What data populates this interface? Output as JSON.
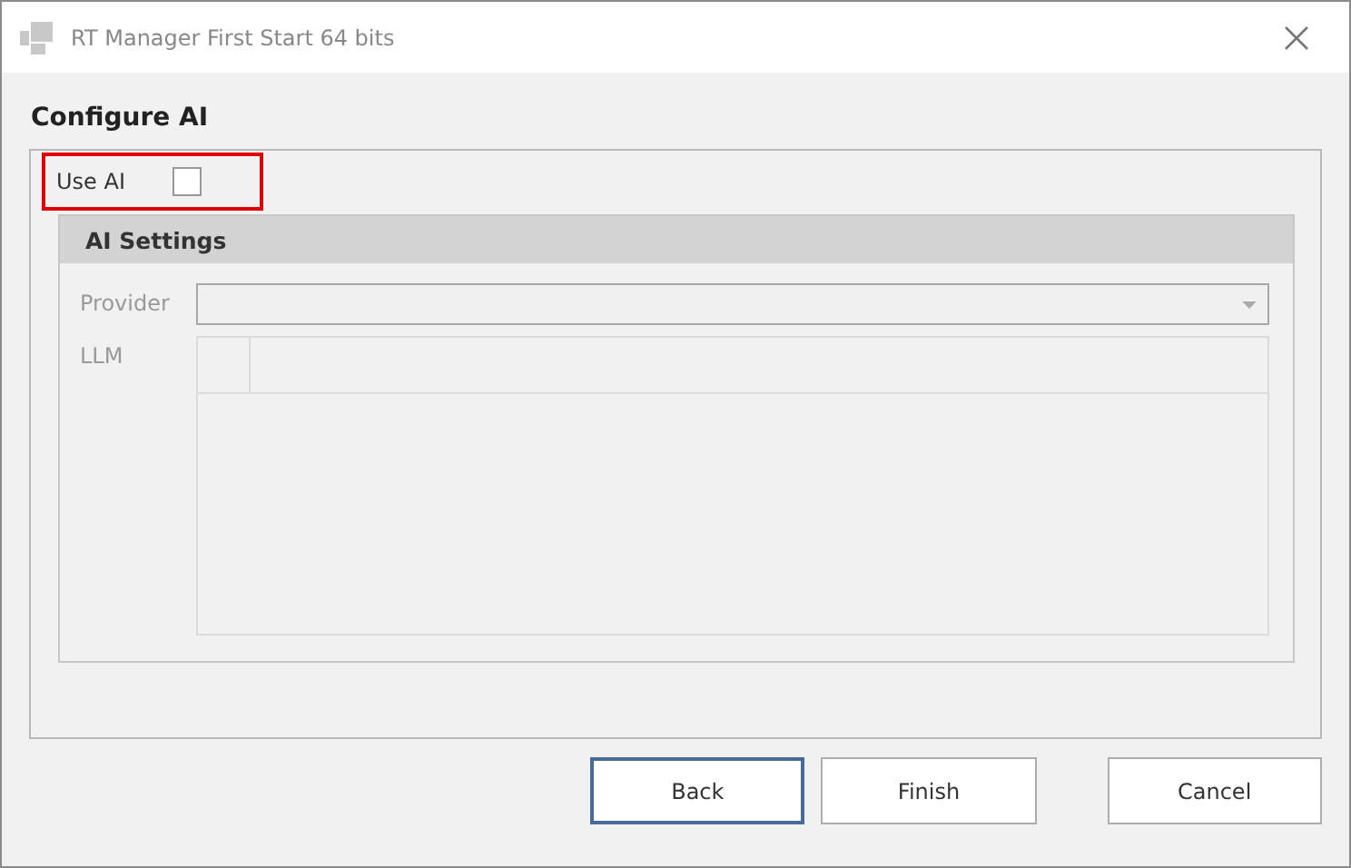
{
  "window": {
    "title": "RT Manager First Start 64 bits"
  },
  "heading": "Configure AI",
  "use_ai": {
    "label": "Use AI",
    "checked": false
  },
  "ai_settings": {
    "title": "AI Settings",
    "disabled": true,
    "provider_label": "Provider",
    "llm_label": "LLM"
  },
  "buttons": [
    {
      "label": "Back",
      "focused": true
    },
    {
      "label": "Finish",
      "focused": false
    },
    {
      "label": "Cancel",
      "focused": false
    }
  ]
}
